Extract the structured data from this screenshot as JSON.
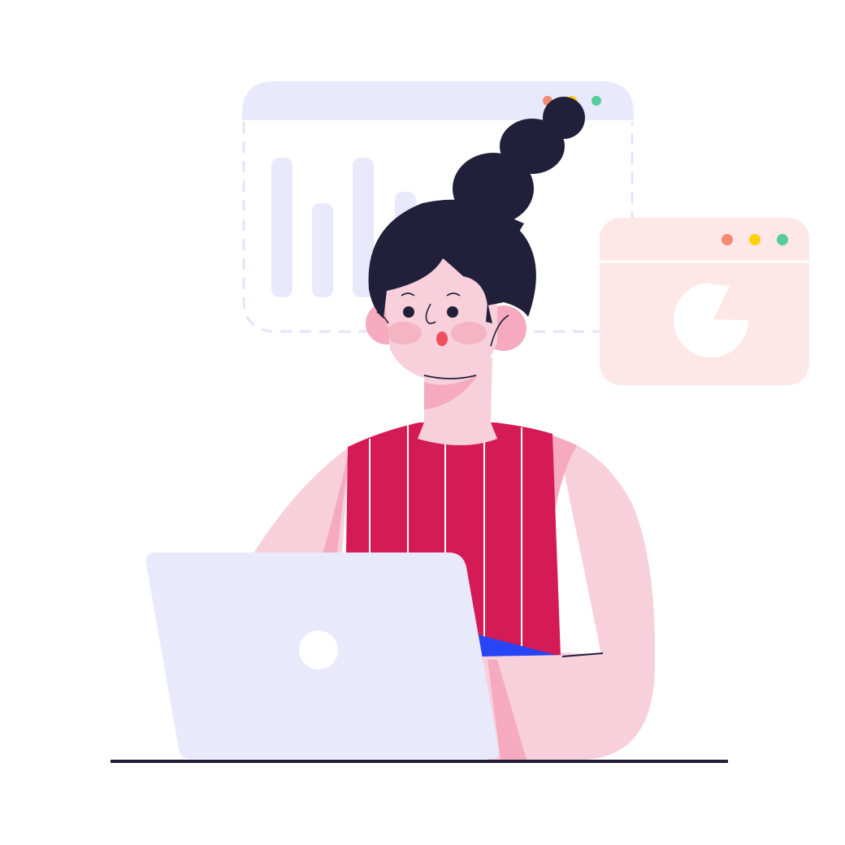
{
  "colors": {
    "background": "#ffffff",
    "window_back": "#E8E9FB",
    "window_back_dash": "#E3E4F8",
    "window_pie": "#FDE8E7",
    "dot_red": "#F58A73",
    "dot_yellow": "#FFD00D",
    "dot_green": "#55CC9C",
    "hair": "#21203A",
    "skin": "#F8D0DB",
    "skin_shadow": "#F6AAC0",
    "blush": "#F2A8B9",
    "mouth": "#F04F5E",
    "shirt": "#D41B55",
    "shirt_stripe": "#FFFFFF",
    "belt": "#2845F5",
    "laptop": "#E8E9FB",
    "laptop_logo": "#FFFFFF",
    "desk_line": "#21203A"
  },
  "icons": {
    "back_window": "bar-chart-window-icon",
    "pie_window": "pie-chart-window-icon",
    "laptop_logo": "laptop-logo-icon"
  }
}
